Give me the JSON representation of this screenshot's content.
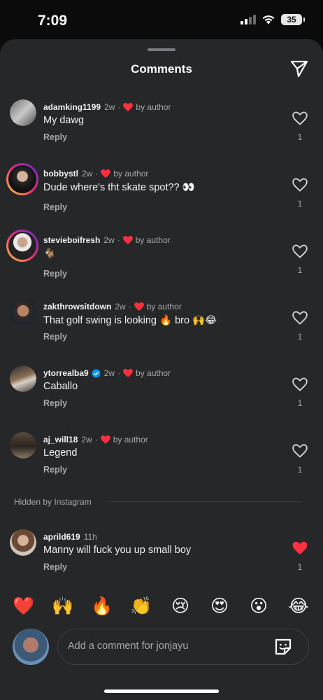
{
  "status_bar": {
    "time": "7:09",
    "battery": "35"
  },
  "sheet": {
    "title": "Comments"
  },
  "comments": [
    {
      "username": "adamking1199",
      "time": "2w",
      "by_author": "by author",
      "text": "My dawg",
      "reply": "Reply",
      "likes": "1"
    },
    {
      "username": "bobbystl",
      "time": "2w",
      "by_author": "by author",
      "text": "Dude where's tht skate spot?? 👀",
      "reply": "Reply",
      "likes": "1"
    },
    {
      "username": "stevieboifresh",
      "time": "2w",
      "by_author": "by author",
      "text": "🐐",
      "reply": "Reply",
      "likes": "1"
    },
    {
      "username": "zakthrowsitdown",
      "time": "2w",
      "by_author": "by author",
      "text": "That golf swing is looking 🔥 bro 🙌😂",
      "reply": "Reply",
      "likes": "1"
    },
    {
      "username": "ytorrealba9",
      "time": "2w",
      "by_author": "by author",
      "text": "Caballo",
      "reply": "Reply",
      "likes": "1"
    },
    {
      "username": "aj_will18",
      "time": "2w",
      "by_author": "by author",
      "text": "Legend",
      "reply": "Reply",
      "likes": "1"
    }
  ],
  "hidden_section": {
    "label": "Hidden by Instagram"
  },
  "hidden_comment": {
    "username": "aprild619",
    "time": "11h",
    "text": "Manny will fuck you up small boy",
    "reply": "Reply",
    "likes": "1",
    "liked": true
  },
  "emoji_bar": [
    "❤️",
    "🙌",
    "🔥",
    "👏",
    "😢",
    "😍",
    "😮",
    "😂"
  ],
  "composer": {
    "placeholder": "Add a comment for jonjayu"
  },
  "colors": {
    "sheet_bg": "#262729",
    "like_red": "#ff3040",
    "verified_blue": "#0095f6",
    "secondary_text": "#a8a8a8"
  },
  "icons": {
    "share": "paper-plane-icon",
    "like": "heart-icon",
    "sticker": "sticker-icon"
  }
}
